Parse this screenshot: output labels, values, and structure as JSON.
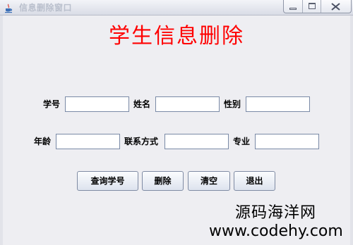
{
  "window": {
    "title": "信息删除窗口",
    "icon": "java-coffee-icon",
    "controls": {
      "minimize": "minimize-icon",
      "maximize": "maximize-icon",
      "close": "close-icon"
    }
  },
  "heading": "学生信息删除",
  "form": {
    "student_id": {
      "label": "学号",
      "value": ""
    },
    "name": {
      "label": "姓名",
      "value": ""
    },
    "gender": {
      "label": "性别",
      "value": ""
    },
    "age": {
      "label": "年龄",
      "value": ""
    },
    "contact": {
      "label": "联系方式",
      "value": ""
    },
    "major": {
      "label": "专业",
      "value": ""
    }
  },
  "buttons": {
    "query": "查询学号",
    "delete": "删除",
    "clear": "清空",
    "exit": "退出"
  },
  "watermark": {
    "site_name": "源码海洋网",
    "url": "www.codehy.com"
  },
  "colors": {
    "heading": "#ff0000",
    "client_bg": "#eeeef2",
    "title_text": "#b9bfcc"
  }
}
